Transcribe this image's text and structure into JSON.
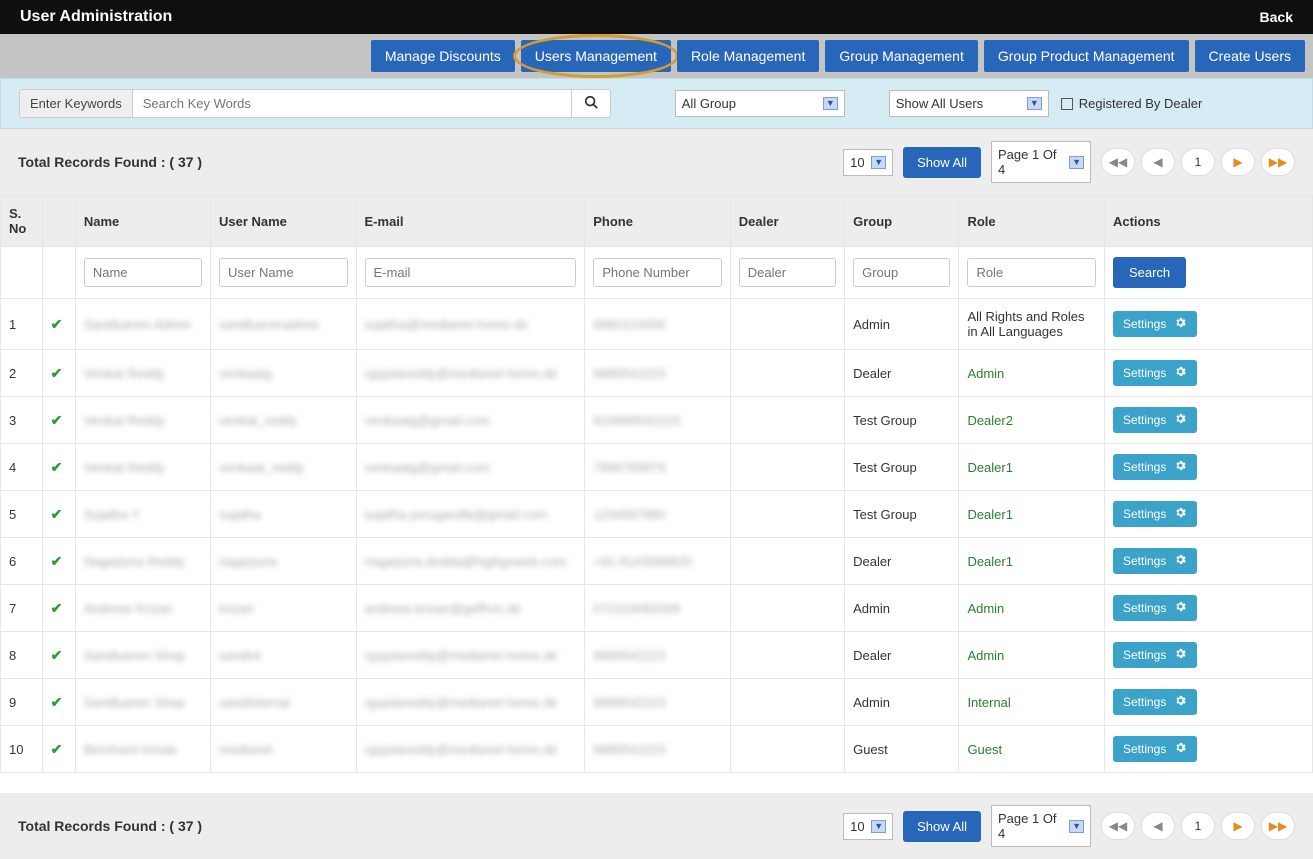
{
  "header": {
    "title": "User Administration",
    "back": "Back"
  },
  "tabs": [
    {
      "label": "Manage Discounts",
      "highlight": false
    },
    {
      "label": "Users Management",
      "highlight": true
    },
    {
      "label": "Role Management",
      "highlight": false
    },
    {
      "label": "Group Management",
      "highlight": false
    },
    {
      "label": "Group Product Management",
      "highlight": false
    },
    {
      "label": "Create Users",
      "highlight": false
    }
  ],
  "filter": {
    "kw_label": "Enter Keywords",
    "kw_placeholder": "Search Key Words",
    "group_selected": "All Group",
    "users_selected": "Show All Users",
    "reg_by_dealer_label": "Registered By Dealer"
  },
  "toolbar": {
    "records_label": "Total Records Found : ( 37 )",
    "per_page": "10",
    "show_all": "Show All",
    "page_sel": "Page 1 Of 4",
    "page_current": "1"
  },
  "columns": {
    "sno": "S. No",
    "name": "Name",
    "uname": "User Name",
    "email": "E-mail",
    "phone": "Phone",
    "dealer": "Dealer",
    "group": "Group",
    "role": "Role",
    "actions": "Actions"
  },
  "filter_row": {
    "name_ph": "Name",
    "uname_ph": "User Name",
    "email_ph": "E-mail",
    "phone_ph": "Phone Number",
    "dealer_ph": "Dealer",
    "group_ph": "Group",
    "role_ph": "Role",
    "search": "Search"
  },
  "settings_label": "Settings",
  "rows": [
    {
      "sno": "1",
      "name": "Sandtueren Admin",
      "uname": "sandtuerenadmin",
      "email": "sujatha@medianet-home.de",
      "phone": "9980123456",
      "dealer": "",
      "group": "Admin",
      "role": "All Rights and Roles in All Languages",
      "role_link": false
    },
    {
      "sno": "2",
      "name": "Venkat Reddy",
      "uname": "venkaatg",
      "email": "rgujulareddy@medianet-home.de",
      "phone": "9989542223",
      "dealer": "",
      "group": "Dealer",
      "role": "Admin",
      "role_link": true
    },
    {
      "sno": "3",
      "name": "Venkat Reddy",
      "uname": "venkat_reddy",
      "email": "venkaatg@gmail.com",
      "phone": "919989542223",
      "dealer": "",
      "group": "Test Group",
      "role": "Dealer2",
      "role_link": true
    },
    {
      "sno": "4",
      "name": "Venkat Reddy",
      "uname": "venkaat_reddy",
      "email": "venkaatg@gmail.com",
      "phone": "7896789879",
      "dealer": "",
      "group": "Test Group",
      "role": "Dealer1",
      "role_link": true
    },
    {
      "sno": "5",
      "name": "Sujatha Y",
      "uname": "sujatha",
      "email": "sujatha.yerugandla@gmail.com",
      "phone": "1234567890",
      "dealer": "",
      "group": "Test Group",
      "role": "Dealer1",
      "role_link": true
    },
    {
      "sno": "6",
      "name": "Nagarjuna Reddy",
      "uname": "nagarjuna",
      "email": "nagarjuna.dodda@highgoweb.com",
      "phone": "+91-8143086820",
      "dealer": "",
      "group": "Dealer",
      "role": "Dealer1",
      "role_link": true
    },
    {
      "sno": "7",
      "name": "Andreas Krizan",
      "uname": "krizan",
      "email": "andreas.krizan@geffron.de",
      "phone": "072319082009",
      "dealer": "",
      "group": "Admin",
      "role": "Admin",
      "role_link": true
    },
    {
      "sno": "8",
      "name": "Sandtueren Shop",
      "uname": "sandint",
      "email": "rgujulareddy@medianet-home.de",
      "phone": "9989542223",
      "dealer": "",
      "group": "Dealer",
      "role": "Admin",
      "role_link": true
    },
    {
      "sno": "9",
      "name": "Sandtueren Shop",
      "uname": "sandinternal",
      "email": "rgujulareddy@medianet-home.de",
      "phone": "9989542223",
      "dealer": "",
      "group": "Admin",
      "role": "Internal",
      "role_link": true
    },
    {
      "sno": "10",
      "name": "Bernhard Hroda",
      "uname": "medianet",
      "email": "rgujulareddy@medianet-home.de",
      "phone": "9989542223",
      "dealer": "",
      "group": "Guest",
      "role": "Guest",
      "role_link": true
    }
  ]
}
